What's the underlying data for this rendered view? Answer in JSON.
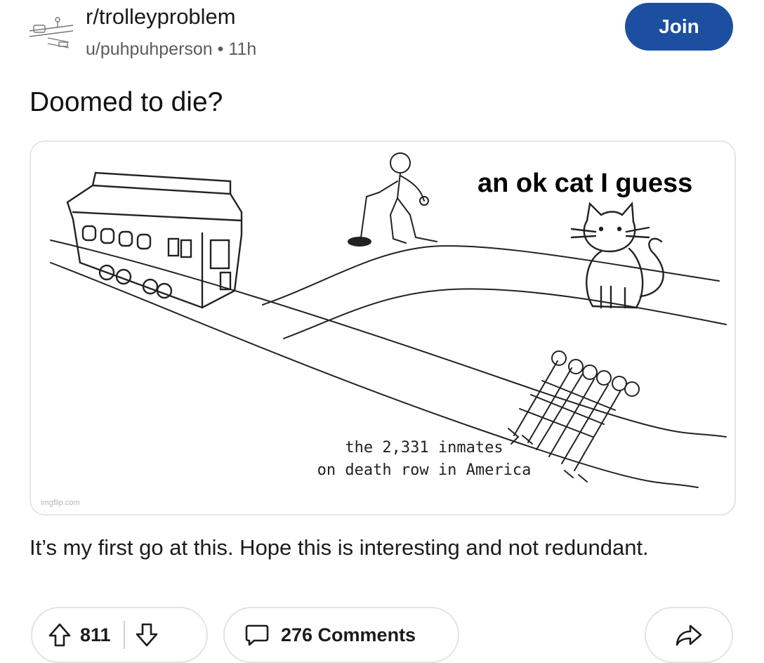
{
  "header": {
    "subreddit": "r/trolleyproblem",
    "user": "u/puhpuhperson",
    "separator": "•",
    "age": "11h",
    "join_label": "Join",
    "accent_color": "#1c4fa0"
  },
  "post": {
    "title": "Doomed to die?",
    "body": "It’s my first go at this. Hope this is interesting and not redundant."
  },
  "image": {
    "cat_caption": "an ok cat I guess",
    "inmates_caption_line1": "the 2,331 inmates",
    "inmates_caption_line2": "on death row in America",
    "watermark": "imgflip.com"
  },
  "actions": {
    "upvote_count": "811",
    "comments_label": "276 Comments",
    "icons": [
      "upvote-icon",
      "downvote-icon",
      "comment-icon",
      "share-icon"
    ]
  }
}
